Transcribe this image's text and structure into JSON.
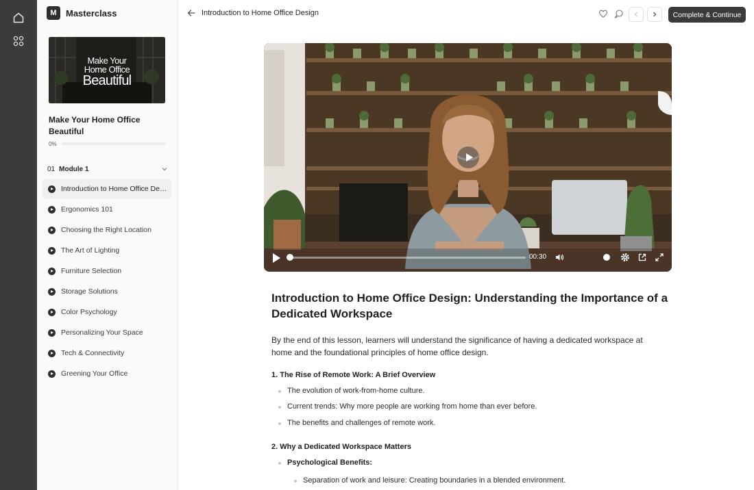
{
  "brand": {
    "logo_letter": "M",
    "name": "Masterclass"
  },
  "course": {
    "thumb_line1": "Make Your",
    "thumb_line2": "Home Office",
    "thumb_line3": "Beautiful",
    "title": "Make Your Home Office Beautiful",
    "progress_label": "0%",
    "progress_value": 0
  },
  "module": {
    "number": "01",
    "name": "Module 1"
  },
  "lessons": [
    {
      "label": "Introduction to Home Office Design",
      "active": true
    },
    {
      "label": "Ergonomics 101"
    },
    {
      "label": "Choosing the Right Location"
    },
    {
      "label": "The Art of Lighting"
    },
    {
      "label": "Furniture Selection"
    },
    {
      "label": "Storage Solutions"
    },
    {
      "label": "Color Psychology"
    },
    {
      "label": "Personalizing Your Space"
    },
    {
      "label": "Tech & Connectivity"
    },
    {
      "label": "Greening Your Office"
    }
  ],
  "topbar": {
    "lesson_title": "Introduction to Home Office Design",
    "complete_label": "Complete & Continue"
  },
  "video": {
    "time": "00:30",
    "progress": 0.0,
    "volume": 0.85
  },
  "article": {
    "title": "Introduction to Home Office Design: Understanding the Importance of a Dedicated Workspace",
    "intro": "By the end of this lesson, learners will understand the significance of having a dedicated workspace at home and the foundational principles of home office design.",
    "section1": "1. The Rise of Remote Work: A Brief Overview",
    "s1_b1": "The evolution of work-from-home culture.",
    "s1_b2": "Current trends: Why more people are working from home than ever before.",
    "s1_b3": "The benefits and challenges of remote work.",
    "section2": "2. Why a Dedicated Workspace Matters",
    "s2_b1": "Psychological Benefits:",
    "s2_b1_sub1": "Separation of work and leisure: Creating boundaries in a blended environment."
  },
  "colors": {
    "rail": "#3b3b3b",
    "accent_dark": "#3a3a3a",
    "sidebar_bg": "#fafafa"
  },
  "icons": {
    "rail": [
      "home-icon",
      "grid-icon"
    ],
    "topbar": [
      "arrow-left-icon",
      "heart-icon",
      "chat-icon",
      "chevron-left-icon",
      "chevron-right-icon"
    ],
    "video": [
      "play-icon",
      "volume-icon",
      "settings-icon",
      "external-link-icon",
      "fullscreen-icon"
    ]
  }
}
